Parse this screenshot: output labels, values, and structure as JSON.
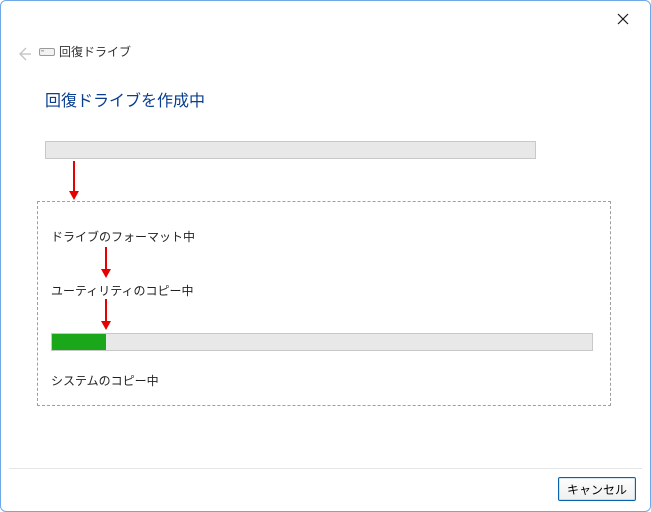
{
  "window": {
    "breadcrumb": "回復ドライブ",
    "title": "回復ドライブを作成中"
  },
  "steps": {
    "step1": "ドライブのフォーマット中",
    "step2": "ユーティリティのコピー中",
    "step3": "システムのコピー中"
  },
  "progress": {
    "top_percent": 0,
    "inner_percent": 10
  },
  "footer": {
    "cancel_label": "キャンセル"
  }
}
